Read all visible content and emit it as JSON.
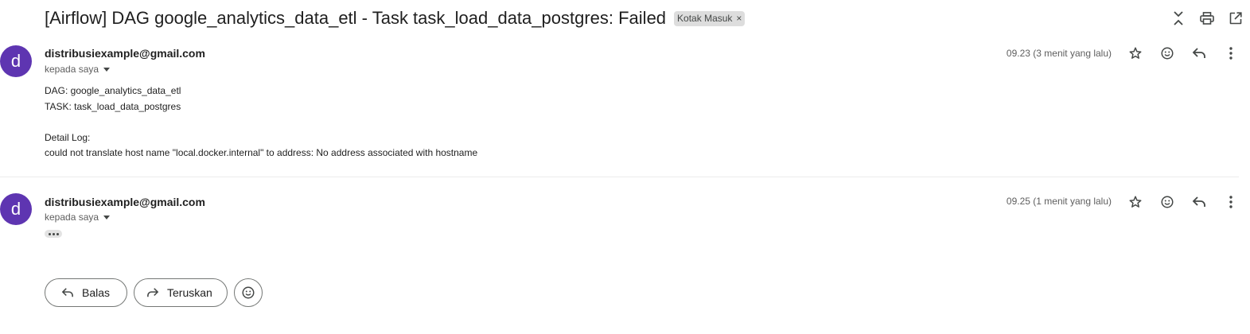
{
  "thread": {
    "subject": "[Airflow] DAG google_analytics_data_etl - Task task_load_data_postgres: Failed",
    "label": "Kotak Masuk",
    "label_remove": "×"
  },
  "top_actions": {
    "collapse_icon": "collapse-all-icon",
    "print_icon": "print-icon",
    "open_new_window_icon": "open-in-new-window-icon"
  },
  "messages": [
    {
      "avatar_letter": "d",
      "sender": "distribusiexample@gmail.com",
      "recipient": "kepada saya",
      "date": "09.23 (3 menit yang lalu)",
      "body": {
        "line1": "DAG: google_analytics_data_etl",
        "line2": "TASK: task_load_data_postgres",
        "line3": "Detail Log:",
        "line4": "could not translate host name \"local.docker.internal\" to address: No address associated with hostname"
      }
    },
    {
      "avatar_letter": "d",
      "sender": "distribusiexample@gmail.com",
      "recipient": "kepada saya",
      "date": "09.25 (1 menit yang lalu)"
    }
  ],
  "footer": {
    "reply_label": "Balas",
    "forward_label": "Teruskan"
  },
  "colors": {
    "avatar": "#5e35b1",
    "chip_bg": "#dddddd",
    "button_border": "#747775"
  }
}
